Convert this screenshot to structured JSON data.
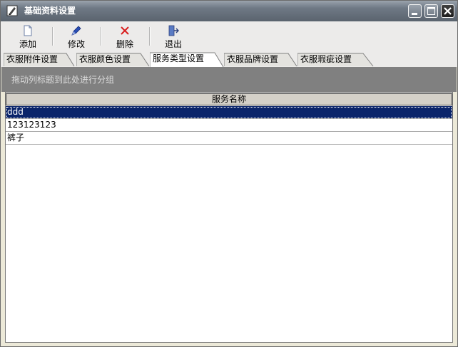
{
  "window": {
    "title": "基础资料设置"
  },
  "toolbar": {
    "add_label": "添加",
    "edit_label": "修改",
    "delete_label": "删除",
    "exit_label": "退出"
  },
  "tabs": [
    {
      "label": "衣服附件设置",
      "active": false
    },
    {
      "label": "衣服颜色设置",
      "active": false
    },
    {
      "label": "服务类型设置",
      "active": true
    },
    {
      "label": "衣服品牌设置",
      "active": false
    },
    {
      "label": "衣服瑕疵设置",
      "active": false
    }
  ],
  "group_panel": {
    "hint": "拖动列标题到此处进行分组"
  },
  "table": {
    "columns": [
      "服务名称"
    ],
    "rows": [
      {
        "name": "ddd",
        "selected": true
      },
      {
        "name": "123123123",
        "selected": false
      },
      {
        "name": "裤子",
        "selected": false
      }
    ]
  },
  "colors": {
    "selection": "#0a246a",
    "group_panel": "#808080",
    "header": "#d4d0c8"
  }
}
